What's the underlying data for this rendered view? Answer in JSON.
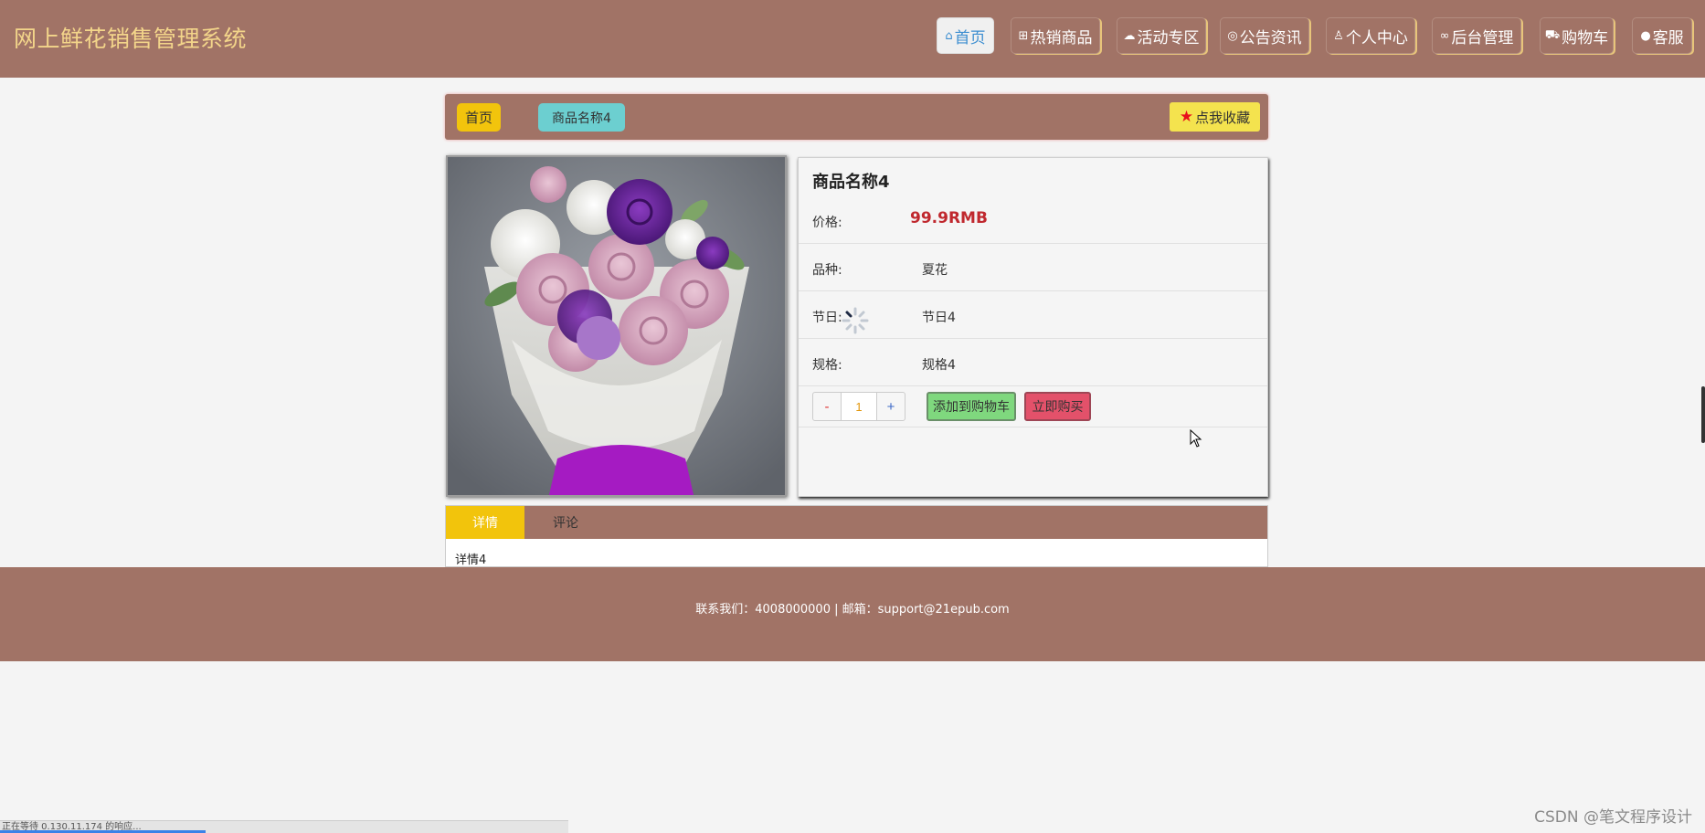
{
  "header": {
    "title": "网上鲜花销售管理系统",
    "nav": [
      {
        "label": "首页",
        "icon": "home-icon",
        "active": true
      },
      {
        "label": "热销商品",
        "icon": "grid-icon",
        "active": false
      },
      {
        "label": "活动专区",
        "icon": "cloud-icon",
        "active": false
      },
      {
        "label": "公告资讯",
        "icon": "bell-icon",
        "active": false
      },
      {
        "label": "个人中心",
        "icon": "user-icon",
        "active": false
      },
      {
        "label": "后台管理",
        "icon": "link-icon",
        "active": false
      },
      {
        "label": "购物车",
        "icon": "cart-icon",
        "active": false
      },
      {
        "label": "客服",
        "icon": "chat-icon",
        "active": false
      }
    ]
  },
  "breadcrumb": {
    "home": "首页",
    "current": "商品名称4",
    "favorite": "点我收藏"
  },
  "product": {
    "name": "商品名称4",
    "price_label": "价格:",
    "price": "99.9RMB",
    "fields": [
      {
        "label": "品种:",
        "value": "夏花"
      },
      {
        "label": "节日:",
        "value": "节日4"
      },
      {
        "label": "规格:",
        "value": "规格4"
      }
    ],
    "quantity": "1",
    "minus": "-",
    "plus": "+",
    "add_to_cart": "添加到购物车",
    "buy_now": "立即购买"
  },
  "tabs": {
    "items": [
      "详情",
      "评论"
    ],
    "active": "详情",
    "content": "详情4"
  },
  "footer": {
    "text": "联系我们：4008000000 | 邮箱：support@21epub.com"
  },
  "browser": {
    "status": "正在等待 0.130.11.174 的响应...",
    "watermark": "CSDN @笔文程序设计"
  },
  "colors": {
    "header_bg": "#a17366",
    "title": "#f3d58a",
    "accent_yellow": "#f2c40c",
    "price": "#c0282e"
  }
}
